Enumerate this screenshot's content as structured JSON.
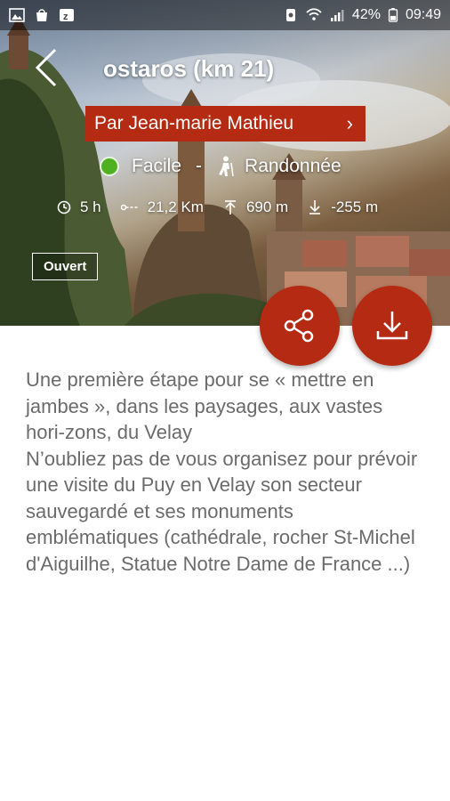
{
  "statusbar": {
    "battery": "42%",
    "time": "09:49"
  },
  "header": {
    "title": "ostaros (km 21)",
    "author_label": "Par Jean-marie Mathieu",
    "author_chevron": "›"
  },
  "trail": {
    "difficulty": "Facile",
    "separator": "-",
    "activity": "Randonnée",
    "duration": "5 h",
    "distance": "21,2 Km",
    "ascent": "690 m",
    "descent": "-255 m",
    "status": "Ouvert"
  },
  "colors": {
    "accent": "#b52a12",
    "difficulty_easy": "#4fb021",
    "text_body": "#6b6b6b"
  },
  "description": "Une première étape pour se « mettre en jambes », dans les paysages, aux vastes hori-zons, du Velay\nN’oubliez pas de vous organisez pour prévoir une visite du Puy en Velay son secteur sauvegardé et ses monuments emblématiques (cathédrale, rocher St-Michel d'Aiguilhe, Statue Notre Dame de France ...)"
}
